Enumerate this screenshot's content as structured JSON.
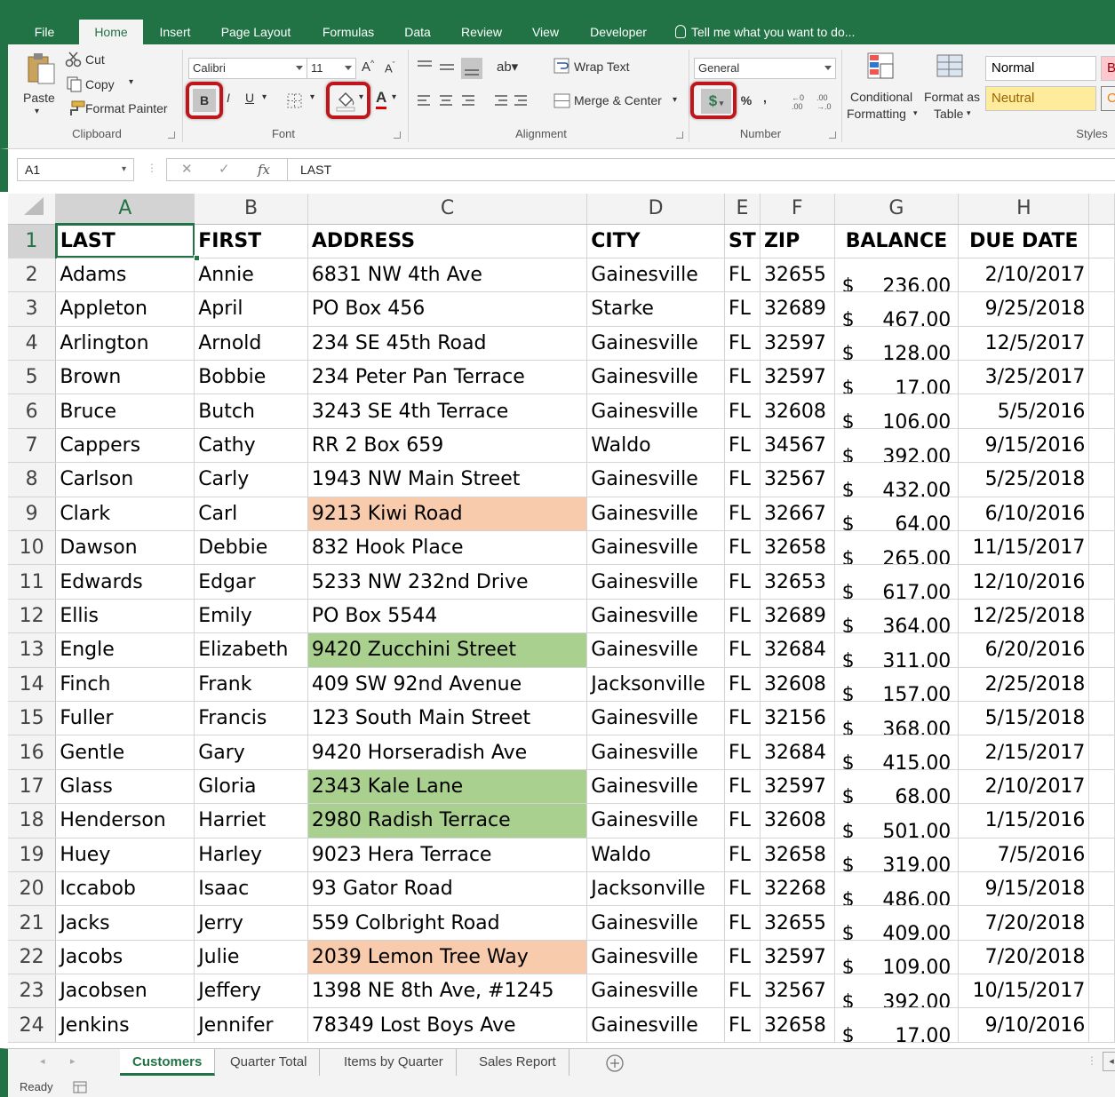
{
  "ribbon_tabs": [
    "File",
    "Home",
    "Insert",
    "Page Layout",
    "Formulas",
    "Data",
    "Review",
    "View",
    "Developer"
  ],
  "tell_me": "Tell me what you want to do...",
  "clipboard": {
    "paste": "Paste",
    "cut": "Cut",
    "copy": "Copy",
    "format_painter": "Format Painter",
    "label": "Clipboard"
  },
  "font": {
    "name": "Calibri",
    "size": "11",
    "bold": "B",
    "italic": "I",
    "underline": "U",
    "label": "Font"
  },
  "alignment": {
    "wrap_text": "Wrap Text",
    "merge_center": "Merge & Center",
    "label": "Alignment"
  },
  "number": {
    "format": "General",
    "currency": "$",
    "percent": "%",
    "comma": ",",
    "label": "Number"
  },
  "styles": {
    "conditional_1": "Conditional",
    "conditional_2": "Formatting",
    "format_as_1": "Format as",
    "format_as_2": "Table",
    "normal": "Normal",
    "bad": "Bad",
    "neutral": "Neutral",
    "calc": "Cal",
    "label": "Styles"
  },
  "name_box": "A1",
  "formula_value": "LAST",
  "columns": [
    "A",
    "B",
    "C",
    "D",
    "E",
    "F",
    "G",
    "H"
  ],
  "header_row": [
    "LAST",
    "FIRST",
    "ADDRESS",
    "CITY",
    "ST",
    "ZIP",
    "BALANCE",
    "DUE DATE"
  ],
  "rows": [
    {
      "last": "Adams",
      "first": "Annie",
      "address": "6831 NW 4th Ave",
      "city": "Gainesville",
      "st": "FL",
      "zip": "32655",
      "balance": "236.00",
      "due": "2/10/2017",
      "fill": ""
    },
    {
      "last": "Appleton",
      "first": "April",
      "address": "PO Box 456",
      "city": "Starke",
      "st": "FL",
      "zip": "32689",
      "balance": "467.00",
      "due": "9/25/2018",
      "fill": ""
    },
    {
      "last": "Arlington",
      "first": "Arnold",
      "address": "234 SE 45th Road",
      "city": "Gainesville",
      "st": "FL",
      "zip": "32597",
      "balance": "128.00",
      "due": "12/5/2017",
      "fill": ""
    },
    {
      "last": "Brown",
      "first": "Bobbie",
      "address": "234 Peter Pan Terrace",
      "city": "Gainesville",
      "st": "FL",
      "zip": "32597",
      "balance": "17.00",
      "due": "3/25/2017",
      "fill": ""
    },
    {
      "last": "Bruce",
      "first": "Butch",
      "address": "3243 SE 4th Terrace",
      "city": "Gainesville",
      "st": "FL",
      "zip": "32608",
      "balance": "106.00",
      "due": "5/5/2016",
      "fill": ""
    },
    {
      "last": "Cappers",
      "first": "Cathy",
      "address": "RR 2 Box 659",
      "city": "Waldo",
      "st": "FL",
      "zip": "34567",
      "balance": "392.00",
      "due": "9/15/2016",
      "fill": ""
    },
    {
      "last": "Carlson",
      "first": "Carly",
      "address": "1943 NW Main Street",
      "city": "Gainesville",
      "st": "FL",
      "zip": "32567",
      "balance": "432.00",
      "due": "5/25/2018",
      "fill": ""
    },
    {
      "last": "Clark",
      "first": "Carl",
      "address": "9213 Kiwi Road",
      "city": "Gainesville",
      "st": "FL",
      "zip": "32667",
      "balance": "64.00",
      "due": "6/10/2016",
      "fill": "#f8cbad"
    },
    {
      "last": "Dawson",
      "first": "Debbie",
      "address": "832 Hook Place",
      "city": "Gainesville",
      "st": "FL",
      "zip": "32658",
      "balance": "265.00",
      "due": "11/15/2017",
      "fill": ""
    },
    {
      "last": "Edwards",
      "first": "Edgar",
      "address": "5233 NW 232nd Drive",
      "city": "Gainesville",
      "st": "FL",
      "zip": "32653",
      "balance": "617.00",
      "due": "12/10/2016",
      "fill": ""
    },
    {
      "last": "Ellis",
      "first": "Emily",
      "address": "PO Box 5544",
      "city": "Gainesville",
      "st": "FL",
      "zip": "32689",
      "balance": "364.00",
      "due": "12/25/2018",
      "fill": ""
    },
    {
      "last": "Engle",
      "first": "Elizabeth",
      "address": "9420 Zucchini Street",
      "city": "Gainesville",
      "st": "FL",
      "zip": "32684",
      "balance": "311.00",
      "due": "6/20/2016",
      "fill": "#a9d08e"
    },
    {
      "last": "Finch",
      "first": "Frank",
      "address": "409 SW 92nd Avenue",
      "city": "Jacksonville",
      "st": "FL",
      "zip": "32608",
      "balance": "157.00",
      "due": "2/25/2018",
      "fill": ""
    },
    {
      "last": "Fuller",
      "first": "Francis",
      "address": "123 South Main Street",
      "city": "Gainesville",
      "st": "FL",
      "zip": "32156",
      "balance": "368.00",
      "due": "5/15/2018",
      "fill": ""
    },
    {
      "last": "Gentle",
      "first": "Gary",
      "address": "9420 Horseradish Ave",
      "city": "Gainesville",
      "st": "FL",
      "zip": "32684",
      "balance": "415.00",
      "due": "2/15/2017",
      "fill": ""
    },
    {
      "last": "Glass",
      "first": "Gloria",
      "address": "2343 Kale Lane",
      "city": "Gainesville",
      "st": "FL",
      "zip": "32597",
      "balance": "68.00",
      "due": "2/10/2017",
      "fill": "#a9d08e"
    },
    {
      "last": "Henderson",
      "first": "Harriet",
      "address": "2980 Radish Terrace",
      "city": "Gainesville",
      "st": "FL",
      "zip": "32608",
      "balance": "501.00",
      "due": "1/15/2016",
      "fill": "#a9d08e"
    },
    {
      "last": "Huey",
      "first": "Harley",
      "address": "9023 Hera Terrace",
      "city": "Waldo",
      "st": "FL",
      "zip": "32658",
      "balance": "319.00",
      "due": "7/5/2016",
      "fill": ""
    },
    {
      "last": "Iccabob",
      "first": "Isaac",
      "address": "93 Gator Road",
      "city": "Jacksonville",
      "st": "FL",
      "zip": "32268",
      "balance": "486.00",
      "due": "9/15/2018",
      "fill": ""
    },
    {
      "last": "Jacks",
      "first": "Jerry",
      "address": "559 Colbright Road",
      "city": "Gainesville",
      "st": "FL",
      "zip": "32655",
      "balance": "409.00",
      "due": "7/20/2018",
      "fill": ""
    },
    {
      "last": "Jacobs",
      "first": "Julie",
      "address": "2039 Lemon Tree Way",
      "city": "Gainesville",
      "st": "FL",
      "zip": "32597",
      "balance": "109.00",
      "due": "7/20/2018",
      "fill": "#f8cbad"
    },
    {
      "last": "Jacobsen",
      "first": "Jeffery",
      "address": "1398 NE 8th Ave, #1245",
      "city": "Gainesville",
      "st": "FL",
      "zip": "32567",
      "balance": "392.00",
      "due": "10/15/2017",
      "fill": ""
    },
    {
      "last": "Jenkins",
      "first": "Jennifer",
      "address": "78349 Lost Boys Ave",
      "city": "Gainesville",
      "st": "FL",
      "zip": "32658",
      "balance": "17.00",
      "due": "9/10/2016",
      "fill": ""
    }
  ],
  "currency_symbol": "$",
  "sheet_tabs": [
    "Customers",
    "Quarter Total",
    "Items by Quarter",
    "Sales Report"
  ],
  "active_sheet": "Customers",
  "status": "Ready",
  "accent": "#217346",
  "highlight": "#c0161b"
}
